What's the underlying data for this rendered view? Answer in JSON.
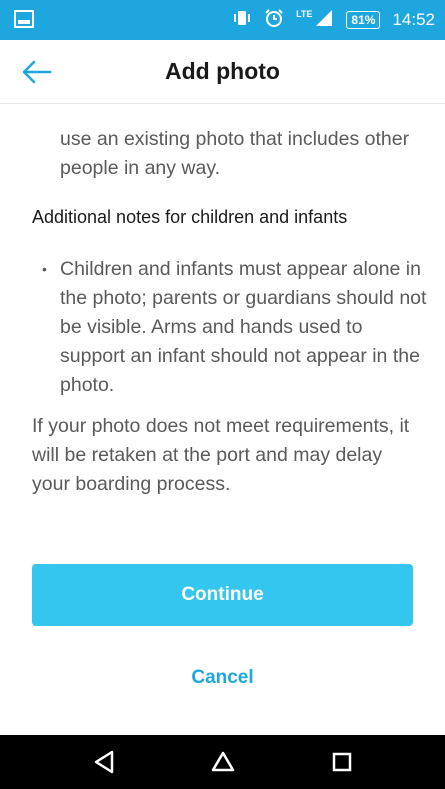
{
  "status_bar": {
    "battery": "81%",
    "network": "LTE",
    "time": "14:52"
  },
  "header": {
    "title": "Add photo"
  },
  "content": {
    "bullet_continuation": "use an existing photo that includes other people in any way.",
    "section_heading": "Additional notes for children and infants",
    "bullet_symbol": "•",
    "bullet_text": "Children and infants must appear alone in the photo; parents or guardians should not be visible. Arms and hands used to support an infant should not appear in the photo.",
    "paragraph": "If your photo does not meet requirements, it will be retaken at the port and may delay your boarding process."
  },
  "actions": {
    "continue_label": "Continue",
    "cancel_label": "Cancel"
  },
  "colors": {
    "status_bar": "#1ea7df",
    "primary_button": "#34c6ee",
    "link": "#1ea7df"
  },
  "icons": {
    "back": "arrow-left-icon",
    "nav_back": "triangle-back-icon",
    "nav_home": "home-icon",
    "nav_recents": "square-recents-icon"
  }
}
